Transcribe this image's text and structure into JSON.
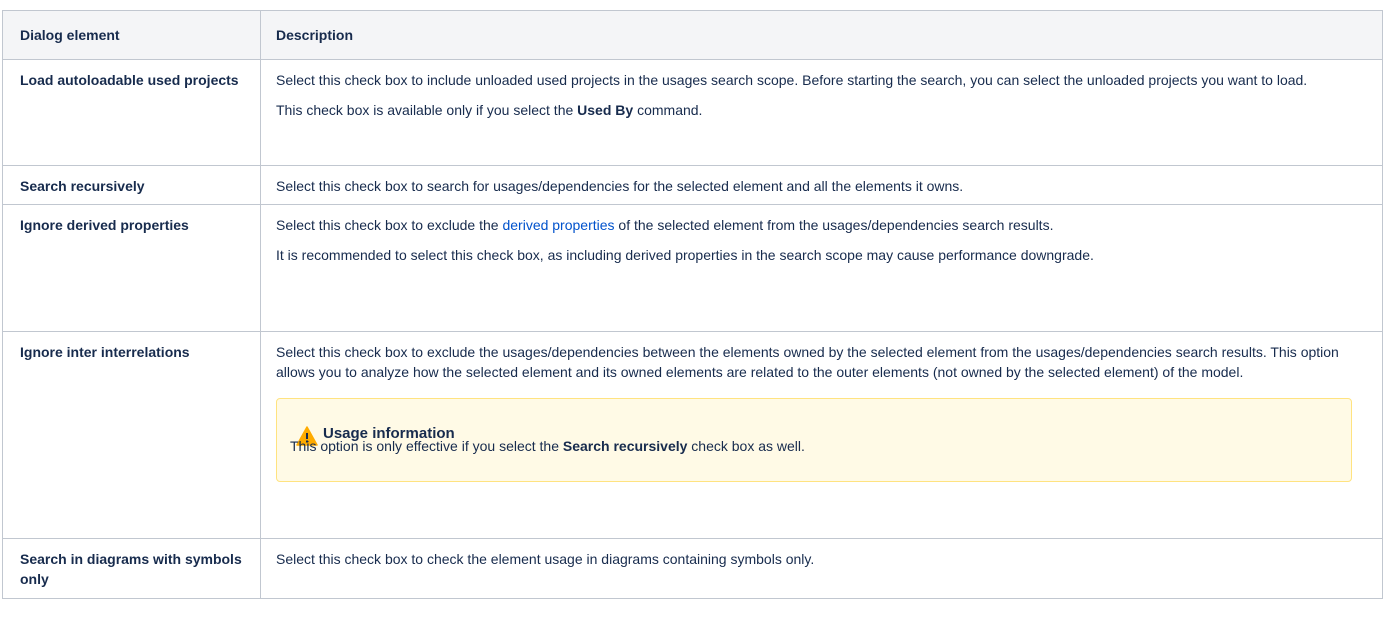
{
  "table": {
    "headers": [
      "Dialog element",
      "Description"
    ],
    "rows": [
      {
        "element": "Load autoloadable used projects",
        "desc1": "Select this check box to include unloaded used projects in the usages search scope. Before starting the search, you can select the unloaded projects you want to load.",
        "desc2_pre": "This check box is available only if you select the ",
        "desc2_bold": "Used By",
        "desc2_post": " command."
      },
      {
        "element": "Search recursively",
        "desc1": "Select this check box to search for usages/dependencies for the selected element and all the elements it owns."
      },
      {
        "element": "Ignore derived properties",
        "desc1_pre": "Select this check box to exclude the ",
        "desc1_link": "derived properties",
        "desc1_post": " of the selected element from the usages/dependencies search results.",
        "desc2": "It is recommended to select this check box, as including derived properties in the search scope may cause performance downgrade."
      },
      {
        "element": "Ignore inter interrelations",
        "desc1": "Select this check box to exclude the usages/dependencies between the elements owned by the selected element from the usages/dependencies search results. This option allows you to analyze how the selected element and its owned elements are related to the outer elements (not owned by the selected element) of the model.",
        "panel": {
          "icon": "warning-icon",
          "title": "Usage information",
          "body_pre": "This option is only effective if you select the ",
          "body_bold": "Search recursively",
          "body_post": " check box as well."
        }
      },
      {
        "element": "Search in diagrams with symbols only",
        "desc1": "Select this check box to check the element usage in diagrams containing symbols only."
      }
    ]
  },
  "colors": {
    "header_bg": "#f4f5f7",
    "border": "#c1c7d0",
    "link": "#0052cc",
    "panel_bg": "#fffae6",
    "panel_border": "#ffe380",
    "warning": "#ffab00"
  }
}
